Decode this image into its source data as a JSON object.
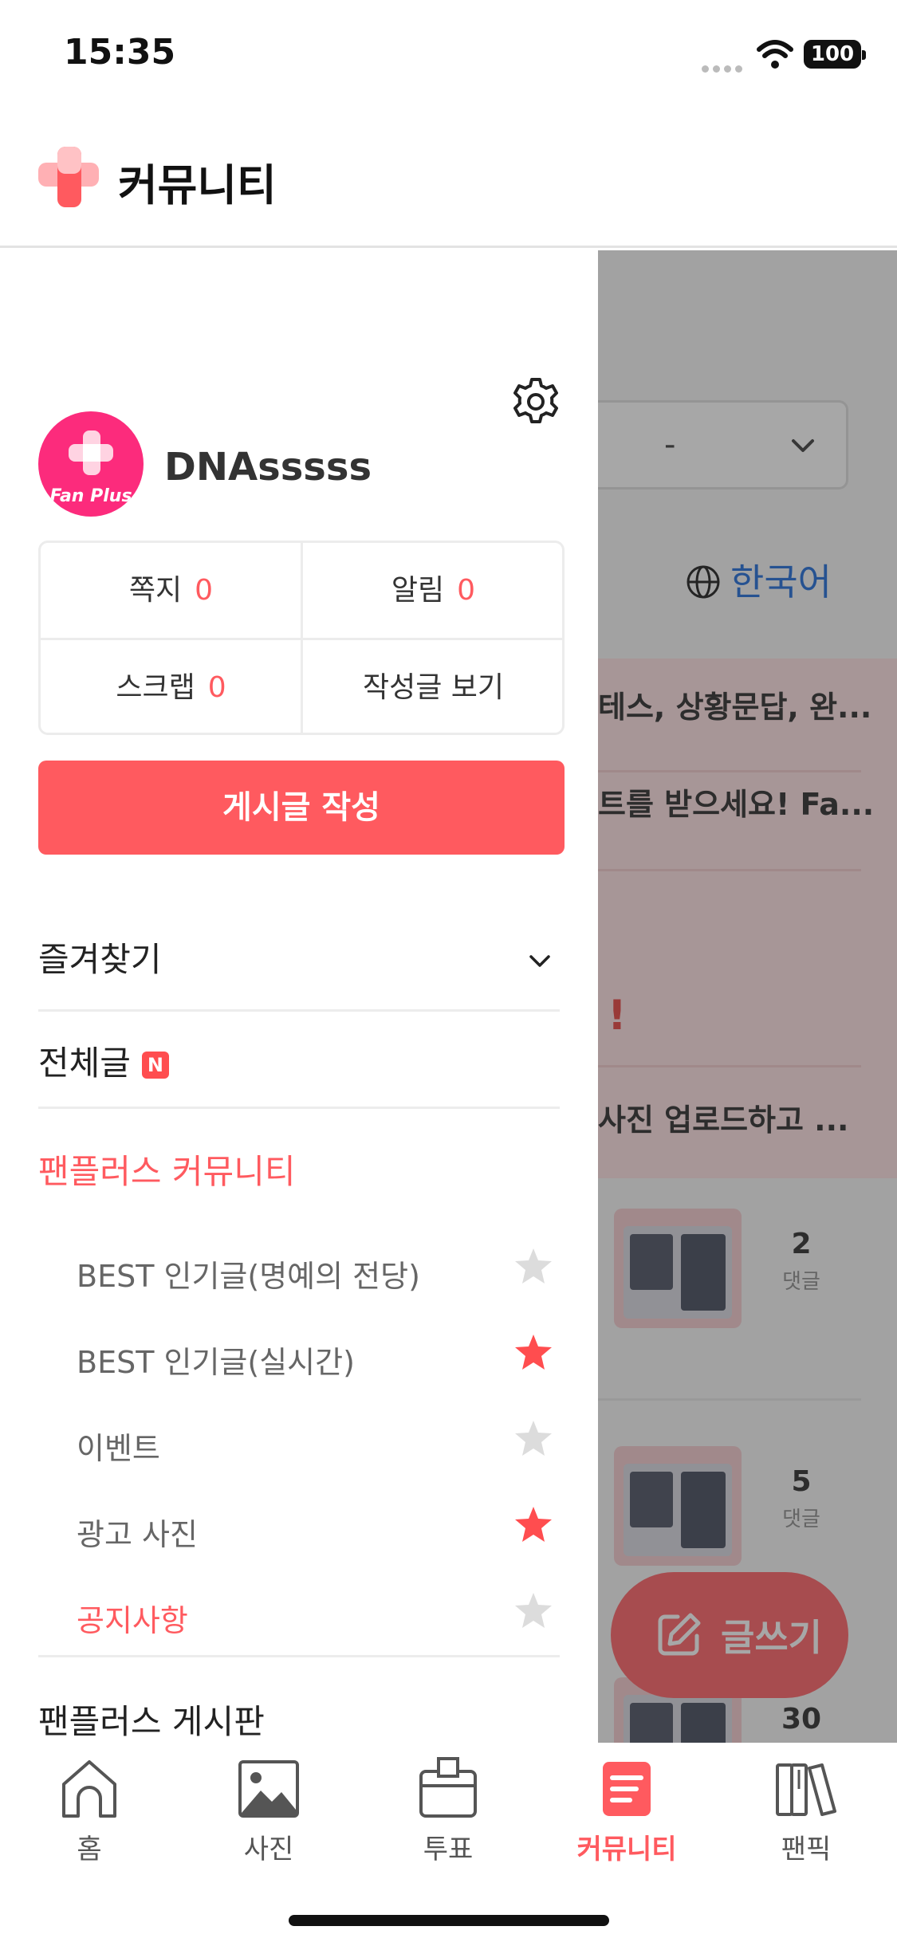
{
  "status_bar": {
    "time": "15:35",
    "battery": "100"
  },
  "header": {
    "title": "커뮤니티"
  },
  "background": {
    "select_value": "-",
    "language": "한국어",
    "notice_lines": [
      "테스, 상황문답, 완...",
      "트를 받으세요! Fa...",
      "!",
      "사진 업로드하고 ..."
    ],
    "posts": [
      {
        "comments": "2",
        "comments_label": "댓글"
      },
      {
        "comments": "5",
        "comments_label": "댓글"
      },
      {
        "comments": "30",
        "comments_label": ""
      }
    ],
    "fab_label": "글쓰기"
  },
  "drawer": {
    "avatar_brand": "Fan Plus",
    "username": "DNAsssss",
    "stats": [
      {
        "label": "쪽지",
        "value": "0"
      },
      {
        "label": "알림",
        "value": "0"
      },
      {
        "label": "스크랩",
        "value": "0"
      },
      {
        "label": "작성글 보기",
        "value": ""
      }
    ],
    "write_button": "게시글 작성",
    "favorites_label": "즐겨찾기",
    "all_posts_label": "전체글",
    "new_badge": "N",
    "community_section": "팬플러스 커뮤니티",
    "items": [
      {
        "label": "BEST 인기글(명예의 전당)",
        "starred": false
      },
      {
        "label": "BEST 인기글(실시간)",
        "starred": true
      },
      {
        "label": "이벤트",
        "starred": false
      },
      {
        "label": "광고 사진",
        "starred": true
      },
      {
        "label": "공지사항",
        "starred": false
      }
    ],
    "board_section": "팬플러스 게시판"
  },
  "bottom_nav": {
    "tabs": [
      {
        "label": "홈",
        "icon": "home-icon",
        "active": false
      },
      {
        "label": "사진",
        "icon": "photo-icon",
        "active": false
      },
      {
        "label": "투표",
        "icon": "vote-icon",
        "active": false
      },
      {
        "label": "커뮤니티",
        "icon": "community-icon",
        "active": true
      },
      {
        "label": "팬픽",
        "icon": "books-icon",
        "active": false
      }
    ]
  },
  "colors": {
    "accent": "#ff5a5f",
    "link": "#1565d8",
    "avatar": "#fc2b7c",
    "star_inactive": "#dcdcdc"
  }
}
